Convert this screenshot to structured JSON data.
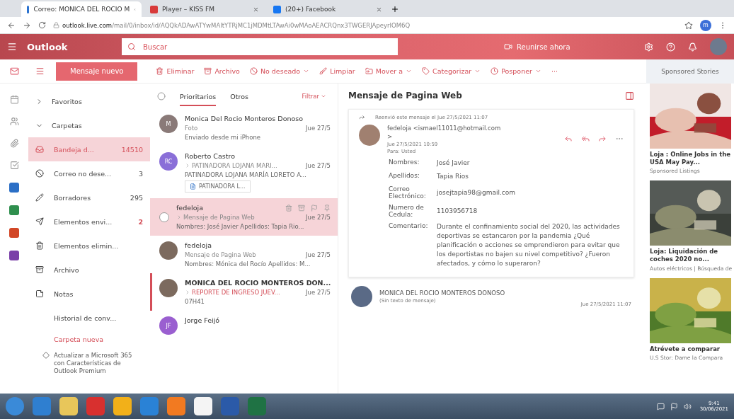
{
  "browser": {
    "tabs": [
      {
        "label": "Correo: MONICA DEL ROCIO M",
        "selected": true
      },
      {
        "label": "Player – KISS FM",
        "selected": false
      },
      {
        "label": "(20+) Facebook",
        "selected": false
      }
    ],
    "url_host": "outlook.live.com",
    "url_path": "/mail/0/inbox/id/AQQkADAwATYwMAItYTRjMC1jMDMtLTAwAi0wMAoAEACRQnx3TWGERJApeyrIOM6Q",
    "profile": "m"
  },
  "header": {
    "app_name": "Outlook",
    "search": {
      "placeholder": "Buscar"
    },
    "meet_now": "Reunirse ahora"
  },
  "new_message": "Mensaje nuevo",
  "toolbar": [
    {
      "label": "Eliminar",
      "menu": false
    },
    {
      "label": "Archivo",
      "menu": false
    },
    {
      "label": "No deseado",
      "menu": true
    },
    {
      "label": "Limpiar",
      "menu": false
    },
    {
      "label": "Mover a",
      "menu": true
    },
    {
      "label": "Categorizar",
      "menu": true
    },
    {
      "label": "Posponer",
      "menu": true
    }
  ],
  "toolbar_more": "···",
  "folders": {
    "favorites": {
      "label": "Favoritos",
      "expanded": false
    },
    "folders_header": {
      "label": "Carpetas",
      "expanded": true
    },
    "items": [
      {
        "label": "Bandeja d...",
        "count": "14510",
        "selected": true,
        "alert": false
      },
      {
        "label": "Correo no dese...",
        "count": "3",
        "selected": false,
        "alert": false
      },
      {
        "label": "Borradores",
        "count": "295",
        "selected": false,
        "alert": false
      },
      {
        "label": "Elementos envi...",
        "count": "2",
        "selected": false,
        "alert": true
      },
      {
        "label": "Elementos elimin...",
        "selected": false
      },
      {
        "label": "Archivo",
        "selected": false
      },
      {
        "label": "Notas",
        "selected": false
      },
      {
        "label": "Historial de conv...",
        "selected": false
      }
    ],
    "new_folder": "Carpeta nueva",
    "upgrade": "Actualizar a Microsoft 365 con Características de Outlook Premium"
  },
  "list": {
    "tabs": [
      {
        "label": "Prioritarios",
        "selected": true
      },
      {
        "label": "Otros",
        "selected": false
      }
    ],
    "filter": "Filtrar",
    "messages": [
      {
        "sender": "Monica Del Rocio Monteros Donoso",
        "subject": "Foto",
        "date": "Jue 27/5",
        "preview": "Enviado desde mi iPhone",
        "avatar": {
          "kind": "initials",
          "text": "M",
          "color": "#8a7a78"
        },
        "selected": false,
        "unread": false,
        "forwarded": false
      },
      {
        "sender": "Roberto Castro",
        "subject": "PATINADORA LOJANA MARI...",
        "date": "Jue 27/5",
        "preview": "PATINADORA LOJANA MARÍA LORETO A...",
        "avatar": {
          "kind": "initials",
          "text": "RC",
          "color": "#8a6fd8"
        },
        "attachment": "PATINADORA L...",
        "selected": false,
        "unread": false,
        "forwarded": true
      },
      {
        "sender": "fedeloja",
        "subject": "Mensaje de Pagina Web",
        "date": "Jue 27/5",
        "preview": "Nombres: José Javier Apellidos: Tapia Rio...",
        "selected": true,
        "unread": false,
        "forwarded": true
      },
      {
        "sender": "fedeloja",
        "subject": "Mensaje de Pagina Web",
        "date": "Jue 27/5",
        "preview": "Nombres: Mónica del Rocío Apellidos: M...",
        "selected": false,
        "unread": false,
        "forwarded": false
      },
      {
        "sender": "MONICA DEL ROCIO MONTEROS DON...",
        "subject": "REPORTE DE INGRESO JUEV...",
        "date": "Jue 27/5",
        "preview": "07H41",
        "selected": false,
        "unread": true,
        "forwarded": true
      },
      {
        "sender": "Jorge Feijó",
        "avatar": {
          "kind": "initials",
          "text": "JF",
          "color": "#9a5fd0"
        },
        "selected": false,
        "unread": false
      }
    ]
  },
  "reading": {
    "subject": "Mensaje de Pagina Web",
    "forward_note": "Reenvió este mensaje el Jue 27/5/2021 11:07",
    "from": "fedeloja <ismael11011@hotmail.com",
    "from_end": ">",
    "sent": "Jue 27/5/2021 10:59",
    "to": "Para: Usted",
    "fields": [
      {
        "label": "Nombres:",
        "value": "José Javier"
      },
      {
        "label": "Apellidos:",
        "value": "Tapia Rios"
      },
      {
        "label": "Correo Electrónico:",
        "value": "josejtapia98@gmail.com"
      },
      {
        "label": "Numero de Cedula:",
        "value": "1103956718"
      },
      {
        "label": "Comentario:",
        "value": "Durante el confinamiento social del 2020, las actividades deportivas se estancaron por la pandemia ¿Qué planificación o acciones se emprendieron para evitar que los deportistas no bajen su nivel competitivo? ¿Fueron afectados, y cómo lo superaron?"
      }
    ],
    "thread": {
      "sender": "MONICA DEL ROCIO MONTEROS DONOSO",
      "preview": "(Sin texto de mensaje)",
      "date": "Jue 27/5/2021 11:07"
    }
  },
  "ads": {
    "title": "Sponsored Stories",
    "items": [
      {
        "title": "Loja : Online Jobs in the USA May Pay...",
        "source": "Sponsored Listings"
      },
      {
        "title": "Loja: Liquidación de coches 2020 no...",
        "source": "Autos eléctricos | Búsqueda de"
      },
      {
        "title": "Atrévete a comparar",
        "source": "U.S Stor: Dame la Compara"
      }
    ]
  },
  "taskbar": {
    "time": "9:41",
    "date": "30/06/2021"
  }
}
